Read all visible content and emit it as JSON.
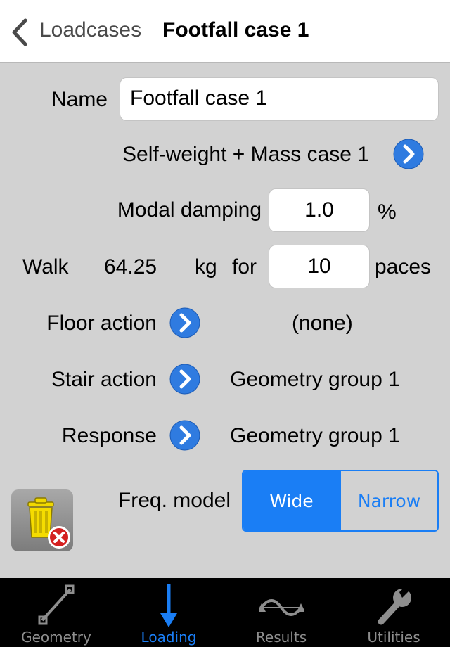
{
  "header": {
    "back_label": "Loadcases",
    "title": "Footfall case 1"
  },
  "form": {
    "name_label": "Name",
    "name_value": "Footfall case 1",
    "mass_case_label": "Self-weight + Mass case 1",
    "damping_label": "Modal damping",
    "damping_value": "1.0",
    "damping_unit": "%",
    "walk_label": "Walk",
    "walk_mass": "64.25",
    "walk_unit": "kg",
    "walk_for": "for",
    "paces_value": "10",
    "paces_label": "paces",
    "floor_action_label": "Floor action",
    "floor_action_value": "(none)",
    "stair_action_label": "Stair action",
    "stair_action_value": "Geometry group 1",
    "response_label": "Response",
    "response_value": "Geometry group 1",
    "freq_model_label": "Freq. model",
    "freq_options": [
      "Wide",
      "Narrow"
    ],
    "freq_selected": "Wide"
  },
  "tabs": [
    {
      "label": "Geometry",
      "icon": "geometry-icon",
      "active": false
    },
    {
      "label": "Loading",
      "icon": "loading-arrow-icon",
      "active": true
    },
    {
      "label": "Results",
      "icon": "results-wave-icon",
      "active": false
    },
    {
      "label": "Utilities",
      "icon": "wrench-icon",
      "active": false
    }
  ],
  "colors": {
    "accent": "#1a7ef5",
    "background": "#d2d2d2",
    "tabbar": "#000000"
  }
}
